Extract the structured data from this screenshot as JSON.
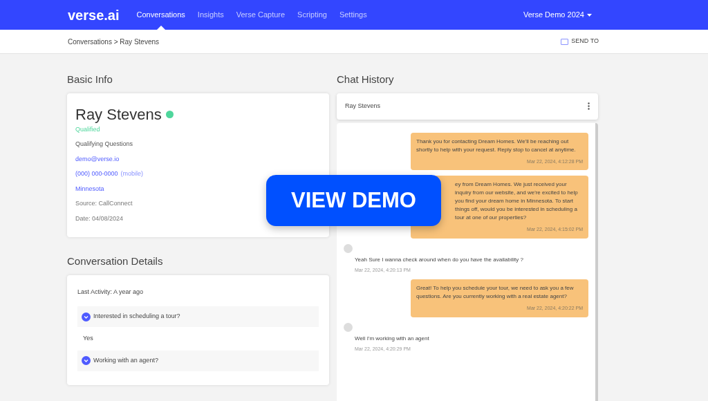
{
  "nav": {
    "logo": "verse.ai",
    "links": [
      {
        "label": "Conversations",
        "selected": true
      },
      {
        "label": "Insights",
        "selected": false
      },
      {
        "label": "Verse Capture",
        "selected": false
      },
      {
        "label": "Scripting",
        "selected": false
      },
      {
        "label": "Settings",
        "selected": false
      }
    ],
    "account": "Verse Demo 2024"
  },
  "breadcrumb": "Conversations > Ray Stevens",
  "send_to": "SEND TO",
  "basic_info": {
    "heading": "Basic Info",
    "name": "Ray Stevens",
    "status": "Qualified",
    "qualifying": "Qualifying Questions",
    "email": "demo@verse.io",
    "phone": "(000) 000-0000",
    "phone_type": "(mobile)",
    "location": "Minnesota",
    "source": "Source: CallConnect",
    "date": "Date: 04/08/2024"
  },
  "details": {
    "heading": "Conversation Details",
    "last_activity": "Last Activity: A year ago",
    "questions": [
      {
        "question": "Interested in scheduling a tour?",
        "answer": "Yes"
      },
      {
        "question": "Working with an agent?"
      }
    ]
  },
  "chat": {
    "heading": "Chat History",
    "contact": "Ray Stevens",
    "messages": [
      {
        "kind": "outgoing",
        "text": "Thank you for contacting Dream Homes. We'll be reaching out shortly to help with your request. Reply stop to cancel at anytime.",
        "time": "Mar 22, 2024, 4:12:28 PM"
      },
      {
        "kind": "outgoing",
        "text": "ey from Dream Homes. We just received your inquiry from our website, and we're excited to help you find your dream home in Minnesota. To start things off, would you be interested in scheduling a tour at one of our properties?",
        "time": "Mar 22, 2024, 4:15:02 PM"
      },
      {
        "kind": "incoming",
        "text": "Yeah Sure I wanna check around when do you have the availability ?",
        "time": "Mar 22, 2024, 4:20:13 PM"
      },
      {
        "kind": "outgoing",
        "text": "Great! To help you schedule your tour, we need to ask you a few questions.  Are you currently working with a real estate agent?",
        "time": "Mar 22, 2024, 4:20:22 PM"
      },
      {
        "kind": "incoming",
        "text": "Well I'm working with an agent",
        "time": "Mar 22, 2024, 4:20:29 PM"
      }
    ]
  },
  "overlay_button": "VIEW DEMO"
}
